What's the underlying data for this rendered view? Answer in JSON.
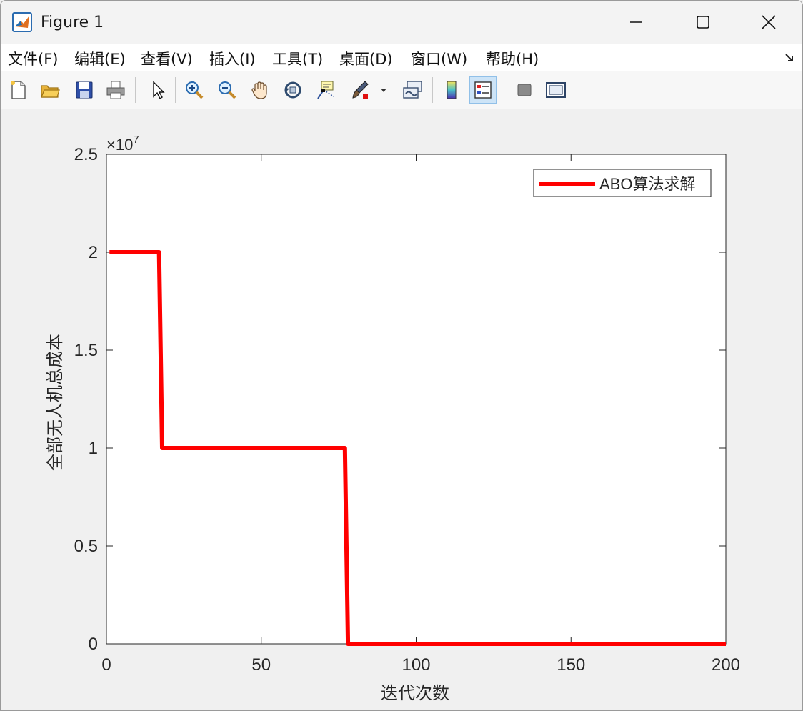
{
  "window": {
    "title": "Figure 1",
    "app_icon": "matlab-icon",
    "controls": [
      "minimize-icon",
      "maximize-icon",
      "close-icon"
    ]
  },
  "menu": {
    "items": [
      {
        "label": "文件(F)"
      },
      {
        "label": "编辑(E)"
      },
      {
        "label": "查看(V)"
      },
      {
        "label": "插入(I)"
      },
      {
        "label": "工具(T)"
      },
      {
        "label": "桌面(D)"
      },
      {
        "label": "窗口(W)"
      },
      {
        "label": "帮助(H)"
      }
    ],
    "expand_icon": "dock-arrow-icon"
  },
  "toolbar": {
    "buttons": [
      {
        "icon": "new-figure-icon"
      },
      {
        "icon": "open-file-icon"
      },
      {
        "icon": "save-icon"
      },
      {
        "icon": "print-icon"
      },
      {
        "icon": "pointer-icon"
      },
      {
        "icon": "zoom-in-icon"
      },
      {
        "icon": "zoom-out-icon"
      },
      {
        "icon": "pan-hand-icon"
      },
      {
        "icon": "rotate-3d-icon"
      },
      {
        "icon": "data-cursor-icon"
      },
      {
        "icon": "brush-icon"
      },
      {
        "icon": "link-plot-icon"
      },
      {
        "icon": "colorbar-icon"
      },
      {
        "icon": "legend-icon",
        "active": true
      },
      {
        "icon": "hide-plot-tools-icon"
      },
      {
        "icon": "show-plot-tools-icon"
      }
    ]
  },
  "chart_data": {
    "type": "line",
    "line_style": "stairs",
    "xlabel": "迭代次数",
    "ylabel": "全部无人机总成本",
    "exponent_label": "×10",
    "exponent_power": "7",
    "xlim": [
      0,
      200
    ],
    "ylim": [
      0,
      2.5
    ],
    "xticks": [
      0,
      50,
      100,
      150,
      200
    ],
    "xtick_labels": [
      "0",
      "50",
      "100",
      "150",
      "200"
    ],
    "yticks": [
      0,
      0.5,
      1,
      1.5,
      2,
      2.5
    ],
    "ytick_labels": [
      "0",
      "0.5",
      "1",
      "1.5",
      "2",
      "2.5"
    ],
    "grid": false,
    "legend_position": "top-right",
    "series": [
      {
        "name": "ABO算法求解",
        "color": "#ff0000",
        "x": [
          1,
          17,
          18,
          77,
          78,
          200
        ],
        "y": [
          2,
          2,
          1,
          1,
          0,
          0
        ]
      }
    ]
  }
}
